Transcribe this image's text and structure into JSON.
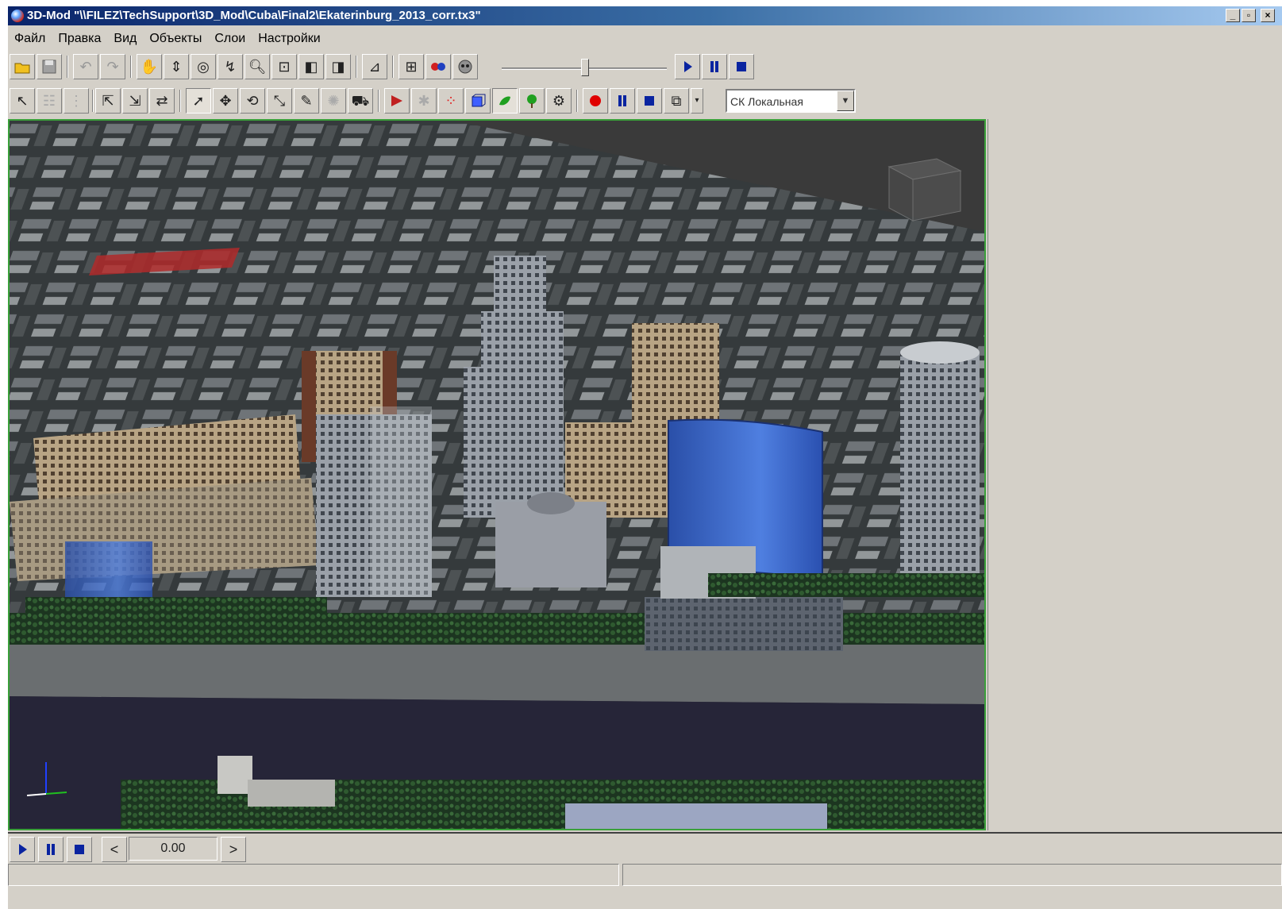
{
  "window": {
    "title": "3D-Mod \"\\\\FILEZ\\TechSupport\\3D_Mod\\Cuba\\Final2\\Ekaterinburg_2013_corr.tx3\"",
    "minimize": "_",
    "maximize": "▫",
    "close": "×"
  },
  "menu": [
    "Файл",
    "Правка",
    "Вид",
    "Объекты",
    "Слои",
    "Настройки"
  ],
  "toolbar2": {
    "coordinate_system": "СК Локальная"
  },
  "timeline": {
    "prev": "<",
    "next": ">",
    "time": "0.00"
  },
  "status": {
    "left": "",
    "right": ""
  },
  "colors": {
    "play": "#0a24a0",
    "record": "#e00000",
    "viewport_border": "#3aa03a"
  }
}
